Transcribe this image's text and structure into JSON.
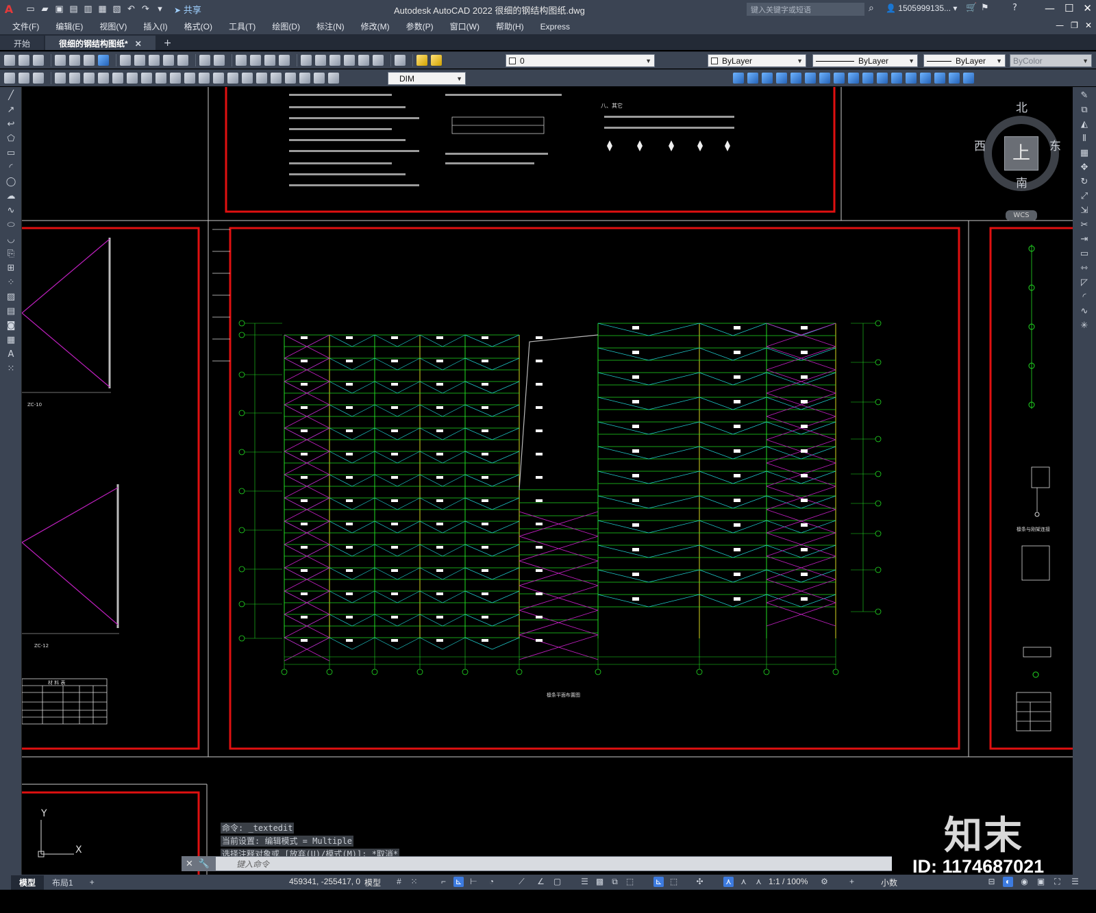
{
  "app": {
    "logo": "A",
    "title": "Autodesk AutoCAD 2022    很细的钢结构图纸.dwg",
    "share_label": "共享",
    "search_placeholder": "键入关键字或短语",
    "user": "1505999135...",
    "window_controls": [
      "—",
      "☐",
      "✕"
    ]
  },
  "menu": {
    "items": [
      "文件(F)",
      "编辑(E)",
      "视图(V)",
      "插入(I)",
      "格式(O)",
      "工具(T)",
      "绘图(D)",
      "标注(N)",
      "修改(M)",
      "参数(P)",
      "窗口(W)",
      "帮助(H)",
      "Express"
    ]
  },
  "tabs": {
    "start": "开始",
    "active": "很细的钢结构图纸*",
    "close": "✕",
    "add": "+"
  },
  "properties": {
    "layer": "0",
    "color": "ByLayer",
    "linetype": "ByLayer",
    "lineweight": "ByLayer",
    "plotstyle": "ByColor",
    "dimstyle": "DIM"
  },
  "viewcube": {
    "north": "北",
    "south": "南",
    "east": "东",
    "west": "西",
    "top": "上",
    "wcs": "WCS"
  },
  "drawing": {
    "notes_heading": "八、其它",
    "detail_labels": [
      "ZC-10",
      "ZC-12"
    ],
    "table_title": "材 料 表",
    "plan_title": "檩条平面布置图",
    "side_detail_label": "檩条与刚架连接"
  },
  "command": {
    "history": [
      "命令: _textedit",
      "当前设置: 编辑模式 = Multiple",
      "选择注释对象或 [放弃(U)/模式(M)]: *取消*"
    ],
    "placeholder": "键入命令"
  },
  "status": {
    "model_tab": "模型",
    "layout_tab": "布局1",
    "add_tab": "+",
    "coords": "459341, -255417, 0",
    "space": "模型",
    "scale": "1:1 / 100%",
    "units": "小数"
  },
  "watermark": {
    "logo": "知末",
    "id": "ID: 1174687021"
  },
  "colors": {
    "frame_red": "#e01010",
    "grid_green": "#22dd22",
    "brace_magenta": "#c020c0",
    "purlin_cyan": "#20d0d0",
    "column_yellow": "#d8d820",
    "ui_dark": "#3b4453"
  }
}
